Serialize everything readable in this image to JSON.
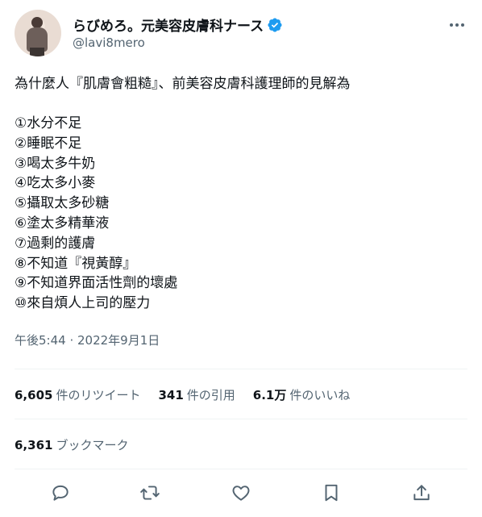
{
  "author": {
    "display_name": "らびめろ。元美容皮膚科ナース",
    "handle": "@lavi8mero",
    "verified_badge_icon": "verified-badge-icon",
    "accent": "#1d9bf0"
  },
  "tweet": {
    "intro": "為什麼人『肌膚會粗糙』、前美容皮膚科護理師的見解為",
    "items": [
      "①水分不足",
      "②睡眠不足",
      "③喝太多牛奶",
      "④吃太多小麥",
      "⑤攝取太多砂糖",
      "⑥塗太多精華液",
      "⑦過剩的護膚",
      "⑧不知道『視黃醇』",
      "⑨不知道界面活性劑的壞處",
      "⑩來自煩人上司的壓力"
    ],
    "timestamp": "午後5:44 · 2022年9月1日"
  },
  "stats": {
    "retweets": {
      "count": "6,605",
      "label": "件のリツイート"
    },
    "quotes": {
      "count": "341",
      "label": "件の引用"
    },
    "likes": {
      "count": "6.1万",
      "label": "件のいいね"
    },
    "bookmarks": {
      "count": "6,361",
      "label": "ブックマーク"
    }
  },
  "actions": [
    "reply-icon",
    "retweet-icon",
    "like-icon",
    "bookmark-icon",
    "share-icon"
  ],
  "colors": {
    "text": "#0f1419",
    "secondary": "#536471",
    "divider": "#eff3f4"
  }
}
